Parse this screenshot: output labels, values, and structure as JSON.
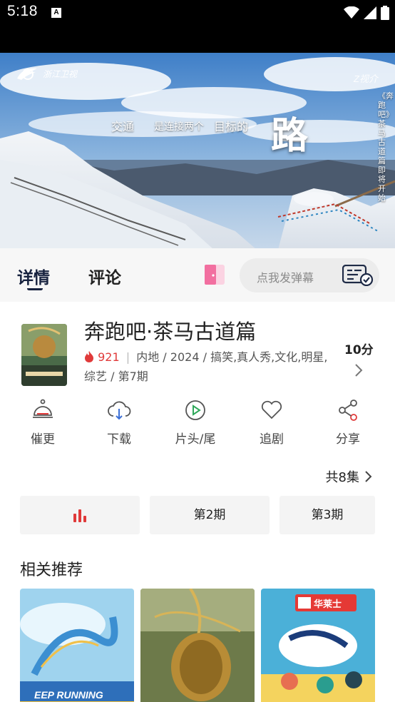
{
  "status": {
    "time": "5:18",
    "notification_icon": "A"
  },
  "video": {
    "channel": "浙江卫视",
    "watermark": "Z视介",
    "subtitle_part1": "交通",
    "subtitle_part2": "是连接两个",
    "subtitle_part3": "目标的",
    "subtitle_big": "路",
    "vertical_caption": "《奔跑吧》茶马古道篇即将开始"
  },
  "tabs": {
    "details": "详情",
    "comments": "评论"
  },
  "danmaku": {
    "placeholder": "点我发弹幕"
  },
  "show": {
    "title": "奔跑吧·茶马古道篇",
    "heat": "921",
    "meta_rest": "内地 / 2024 / 搞笑,真人秀,文化,明星,综艺 / 第7期",
    "score": "10分"
  },
  "actions": [
    {
      "label": "催更",
      "icon": "bell-icon"
    },
    {
      "label": "下载",
      "icon": "cloud-download-icon"
    },
    {
      "label": "片头/尾",
      "icon": "play-circle-icon"
    },
    {
      "label": "追剧",
      "icon": "heart-icon"
    },
    {
      "label": "分享",
      "icon": "share-icon"
    }
  ],
  "episodes": {
    "count_label": "共8集",
    "items": [
      {
        "label": "",
        "playing": true
      },
      {
        "label": "第2期"
      },
      {
        "label": "第3期"
      }
    ]
  },
  "related": {
    "title": "相关推荐",
    "items": [
      {
        "overlay_text": "EEP RUNNING"
      },
      {
        "overlay_text": ""
      },
      {
        "overlay_text": "华莱士"
      }
    ]
  },
  "colors": {
    "accent_red": "#e03a3a",
    "tab_active": "#17223f",
    "door_pink": "#f26fa0"
  }
}
